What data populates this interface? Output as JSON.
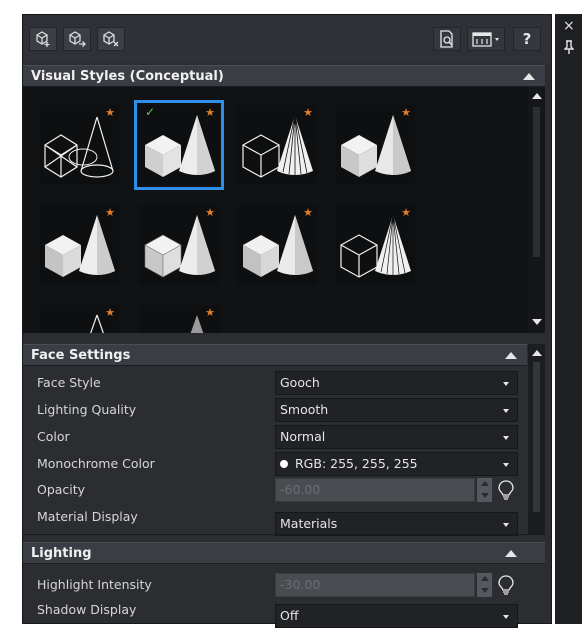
{
  "toolbar": {
    "left_icons": [
      "create-visual-style-icon",
      "apply-to-viewport-icon",
      "delete-visual-style-icon"
    ],
    "right_icons": [
      "preview-icon",
      "tool-palette-icon",
      "help-icon"
    ],
    "help_label": "?"
  },
  "window": {
    "close_glyph": "×",
    "pin_glyph": "⯯"
  },
  "visual_styles": {
    "title": "Visual Styles (Conceptual)",
    "thumbnails": [
      {
        "style": "wireframe-cone",
        "star": "★",
        "selected": false
      },
      {
        "style": "conceptual",
        "star": "★",
        "selected": true,
        "check": "✓"
      },
      {
        "style": "hidden-lines",
        "star": "★",
        "selected": false
      },
      {
        "style": "realistic",
        "star": "★",
        "selected": false
      },
      {
        "style": "shaded",
        "star": "★",
        "selected": false
      },
      {
        "style": "shaded-with-edges",
        "star": "★",
        "selected": false
      },
      {
        "style": "shades-of-gray",
        "star": "★",
        "selected": false
      },
      {
        "style": "sketchy",
        "star": "★",
        "selected": false
      },
      {
        "style": "x-ray",
        "star": "★",
        "selected": false
      },
      {
        "style": "partial-1",
        "star": "★",
        "selected": false
      },
      {
        "style": "partial-2",
        "star": "★",
        "selected": false
      }
    ]
  },
  "face_settings": {
    "title": "Face Settings",
    "rows": [
      {
        "label": "Face Style",
        "value": "Gooch"
      },
      {
        "label": "Lighting Quality",
        "value": "Smooth"
      },
      {
        "label": "Color",
        "value": "Normal"
      },
      {
        "label": "Monochrome Color",
        "value": "RGB: 255, 255, 255"
      },
      {
        "label": "Opacity",
        "value": "-60.00"
      },
      {
        "label": "Material Display",
        "value": "Materials"
      }
    ]
  },
  "lighting": {
    "title": "Lighting",
    "rows": [
      {
        "label": "Highlight Intensity",
        "value": "-30.00"
      },
      {
        "label": "Shadow Display",
        "value": "Off"
      }
    ]
  },
  "colors": {
    "selection": "#2f8ee8",
    "star": "#e27c2a",
    "check": "#62c45a"
  }
}
